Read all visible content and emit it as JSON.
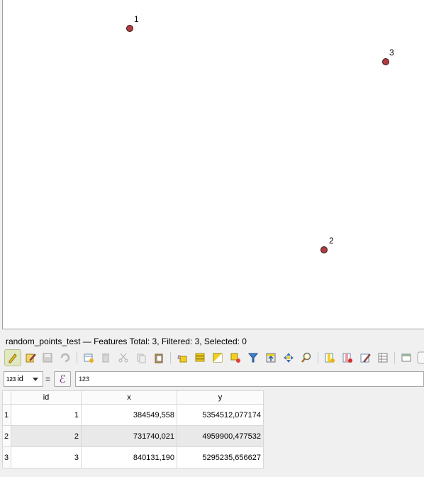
{
  "map": {
    "point_labels": [
      "1",
      "2",
      "3"
    ],
    "point_color": "#b33a40"
  },
  "status": {
    "text": "random_points_test — Features Total: 3, Filtered: 3, Selected: 0"
  },
  "toolbar": {
    "icons": [
      "toggle-editing-icon",
      "multi-edit-icon",
      "save-edits-icon",
      "reload-icon",
      "add-feature-icon",
      "delete-feature-icon",
      "cut-icon",
      "copy-icon",
      "paste-icon",
      "select-by-expression-icon",
      "select-all-icon",
      "invert-selection-icon",
      "deselect-all-icon",
      "filter-icon",
      "move-selection-to-top-icon",
      "pan-to-selection-icon",
      "zoom-to-selection-icon",
      "new-field-icon",
      "delete-field-icon",
      "field-calculator-icon",
      "conditional-formatting-icon",
      "dock-table-icon"
    ]
  },
  "filter": {
    "field_type": "123",
    "field_name": "id",
    "equals": "=",
    "expression_symbol": "ℰ",
    "value_placeholder": "123"
  },
  "table": {
    "columns": [
      "id",
      "x",
      "y"
    ],
    "rows": [
      {
        "num": "1",
        "id": "1",
        "x": "384549,558",
        "y": "5354512,077174"
      },
      {
        "num": "2",
        "id": "2",
        "x": "731740,021",
        "y": "4959900,477532"
      },
      {
        "num": "3",
        "id": "3",
        "x": "840131,190",
        "y": "5295235,656627"
      }
    ]
  }
}
